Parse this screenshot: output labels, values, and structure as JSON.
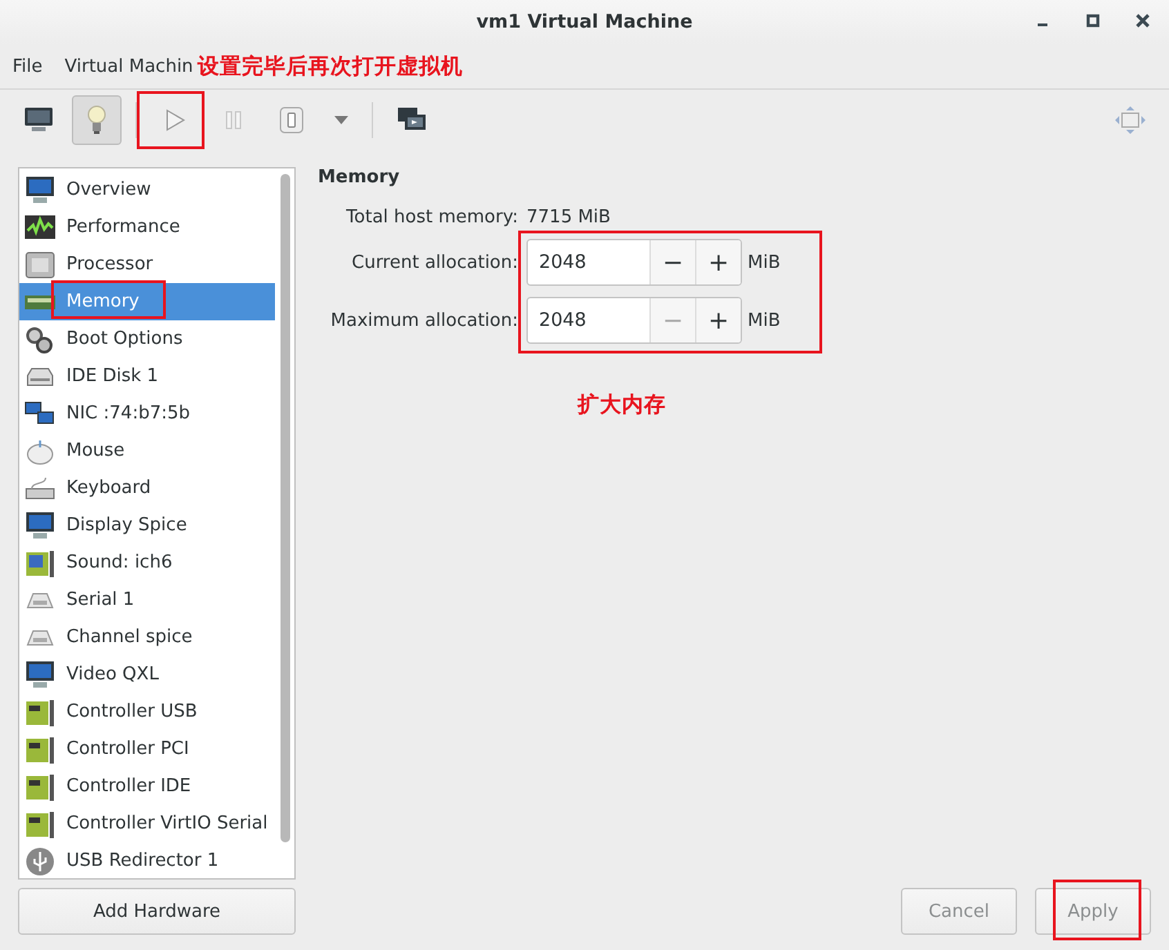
{
  "window": {
    "title": "vm1 Virtual Machine"
  },
  "menu": [
    "File",
    "Virtual Machin"
  ],
  "toolbar": {
    "view_buttons": [
      {
        "selected": false
      },
      {
        "selected": true
      }
    ],
    "pause_disabled": true
  },
  "sidebar": {
    "items": [
      {
        "label": "Overview",
        "selected": false
      },
      {
        "label": "Performance",
        "selected": false
      },
      {
        "label": "Processor",
        "selected": false
      },
      {
        "label": "Memory",
        "selected": true
      },
      {
        "label": "Boot Options",
        "selected": false
      },
      {
        "label": "IDE Disk 1",
        "selected": false
      },
      {
        "label": "NIC :74:b7:5b",
        "selected": false
      },
      {
        "label": "Mouse",
        "selected": false
      },
      {
        "label": "Keyboard",
        "selected": false
      },
      {
        "label": "Display Spice",
        "selected": false
      },
      {
        "label": "Sound: ich6",
        "selected": false
      },
      {
        "label": "Serial 1",
        "selected": false
      },
      {
        "label": "Channel spice",
        "selected": false
      },
      {
        "label": "Video QXL",
        "selected": false
      },
      {
        "label": "Controller USB",
        "selected": false
      },
      {
        "label": "Controller PCI",
        "selected": false
      },
      {
        "label": "Controller IDE",
        "selected": false
      },
      {
        "label": "Controller VirtIO Serial",
        "selected": false
      },
      {
        "label": "USB Redirector 1",
        "selected": false
      }
    ],
    "add_button": "Add Hardware"
  },
  "memory": {
    "heading": "Memory",
    "host_label": "Total host memory:",
    "host_value": "7715 MiB",
    "fields": [
      {
        "label": "Current allocation:",
        "value": "2048",
        "minus": "−",
        "plus": "+",
        "minus_disabled": false,
        "unit": "MiB"
      },
      {
        "label": "Maximum allocation:",
        "value": "2048",
        "minus": "−",
        "plus": "+",
        "minus_disabled": true,
        "unit": "MiB"
      }
    ]
  },
  "buttons": [
    {
      "label": "Cancel",
      "disabled": true
    },
    {
      "label": "Apply",
      "disabled": true
    }
  ],
  "annotations": {
    "run_note": "设置完毕后再次打开虚拟机",
    "memory_note": "扩大内存"
  }
}
